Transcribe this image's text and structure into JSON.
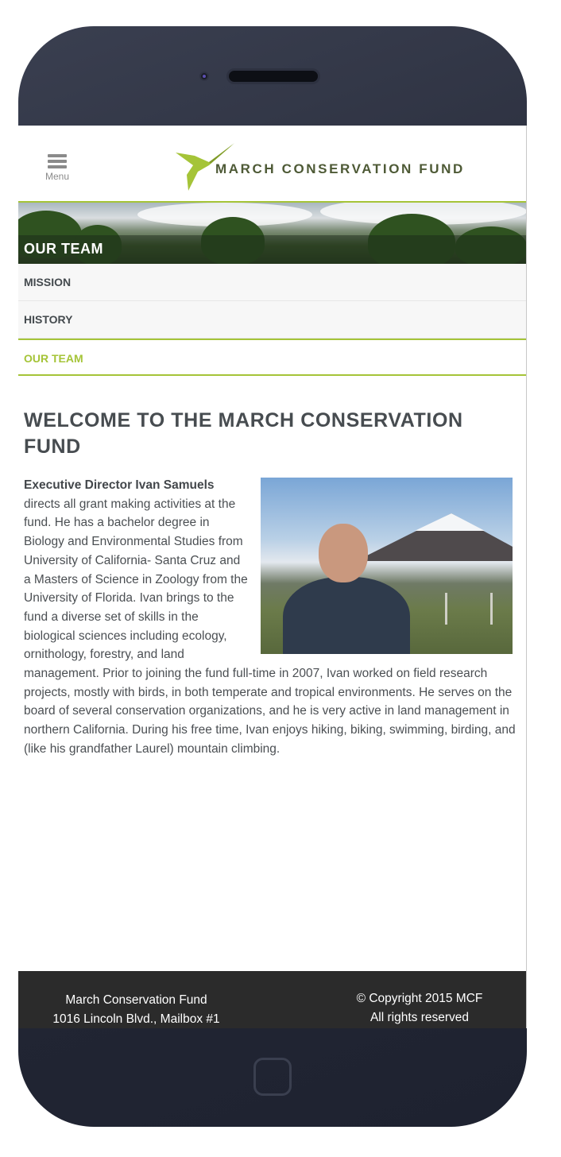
{
  "header": {
    "menu_label": "Menu",
    "logo_text": "MARCH CONSERVATION FUND"
  },
  "banner": {
    "title": "OUR TEAM"
  },
  "subnav": {
    "items": [
      {
        "label": "MISSION"
      },
      {
        "label": "HISTORY"
      },
      {
        "label": "OUR TEAM"
      }
    ],
    "active": "OUR TEAM"
  },
  "main": {
    "title": "WELCOME TO THE MARCH CONSERVATION FUND",
    "lead": "Executive Director Ivan Samuels",
    "body": "directs all grant making activities at the fund. He has a bachelor degree in Biology and Environmental Studies from University of California- Santa Cruz and a Masters of Science in Zoology from the University of Florida. Ivan brings to the fund a diverse set of skills in the biological sciences including ecology, ornithology, forestry, and land management. Prior to joining the fund full-time in 2007, Ivan worked on field research projects, mostly with birds, in both temperate and tropical environments. He serves on the board of several conservation organizations, and he is very active in land management in northern California. During his free time, Ivan enjoys hiking, biking, swimming, birding, and (like his grandfather Laurel) mountain climbing."
  },
  "footer": {
    "org_name": "March Conservation Fund",
    "address": "1016 Lincoln Blvd., Mailbox #1",
    "copyright": "© Copyright 2015 MCF",
    "rights": "All rights reserved"
  },
  "colors": {
    "accent": "#a5c438",
    "footer_bg": "#2b2b2b",
    "phone_frame": "#262a38"
  }
}
